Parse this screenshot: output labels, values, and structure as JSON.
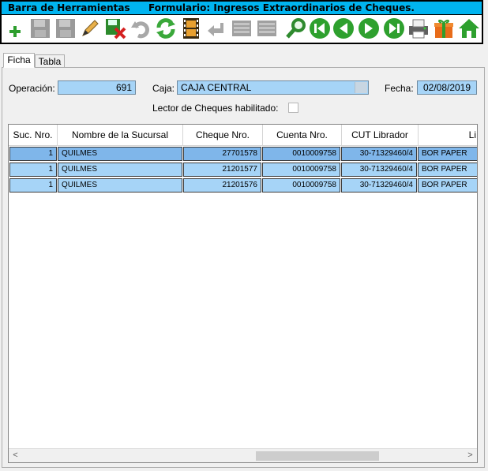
{
  "window": {
    "app_title": "Barra de Herramientas",
    "form_title": "Formulario: Ingresos Extraordinarios de Cheques."
  },
  "toolbar": {
    "buttons": [
      {
        "icon": "add-icon",
        "enabled": true
      },
      {
        "icon": "save-icon",
        "enabled": false
      },
      {
        "icon": "save-as-icon",
        "enabled": false
      },
      {
        "icon": "edit-icon",
        "enabled": true
      },
      {
        "icon": "delete-save-icon",
        "enabled": true
      },
      {
        "icon": "undo-icon",
        "enabled": false
      },
      {
        "icon": "refresh-icon",
        "enabled": true
      },
      {
        "icon": "film-icon",
        "enabled": true
      },
      {
        "icon": "back-arrow-icon",
        "enabled": false
      },
      {
        "icon": "grid-icon",
        "enabled": false
      },
      {
        "icon": "grid-alt-icon",
        "enabled": false
      },
      {
        "icon": "search-icon",
        "enabled": true
      },
      {
        "icon": "first-record-icon",
        "enabled": true
      },
      {
        "icon": "previous-record-icon",
        "enabled": true
      },
      {
        "icon": "next-record-icon",
        "enabled": true
      },
      {
        "icon": "last-record-icon",
        "enabled": true
      },
      {
        "icon": "print-icon",
        "enabled": true
      },
      {
        "icon": "gift-icon",
        "enabled": true
      },
      {
        "icon": "home-icon",
        "enabled": true
      }
    ]
  },
  "tabs": [
    {
      "label": "Ficha",
      "active": true
    },
    {
      "label": "Tabla",
      "active": false
    }
  ],
  "form": {
    "operacion_label": "Operación:",
    "operacion_value": "691",
    "caja_label": "Caja:",
    "caja_value": "CAJA CENTRAL",
    "fecha_label": "Fecha:",
    "fecha_value": "02/08/2019",
    "lector_label": "Lector de Cheques habilitado:",
    "lector_checked": false
  },
  "grid": {
    "columns": [
      "Suc. Nro.",
      "Nombre de la Sucursal",
      "Cheque Nro.",
      "Cuenta Nro.",
      "CUT Librador",
      "Li"
    ],
    "rows": [
      [
        "1",
        "QUILMES",
        "27701578",
        "0010009758",
        "30-71329460/4",
        "BOR PAPER"
      ],
      [
        "1",
        "QUILMES",
        "21201577",
        "0010009758",
        "30-71329460/4",
        "BOR PAPER"
      ],
      [
        "1",
        "QUILMES",
        "21201576",
        "0010009758",
        "30-71329460/4",
        "BOR PAPER"
      ]
    ],
    "selected_row": 0,
    "scroll_left_label": "<",
    "scroll_right_label": ">"
  },
  "colors": {
    "titlebar": "#00b4f0",
    "field": "#a6d4f7",
    "row_selected": "#7fb6ea",
    "row": "#a6d4f7"
  }
}
